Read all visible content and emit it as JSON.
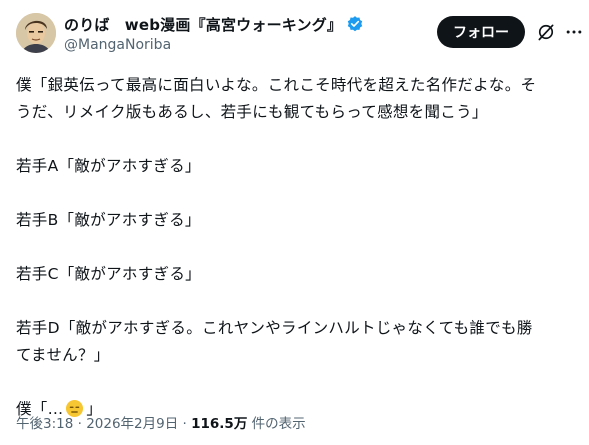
{
  "author": {
    "display_name": "のりば　web漫画『高宮ウォーキング』",
    "handle": "@MangaNoriba"
  },
  "actions": {
    "follow_label": "フォロー"
  },
  "tweet": {
    "line1": "僕「銀英伝って最高に面白いよな。これこそ時代を超えた名作だよな。そ",
    "line2": "うだ、リメイク版もあるし、若手にも観てもらって感想を聞こう」",
    "line3": "若手A「敵がアホすぎる」",
    "line4": "若手B「敵がアホすぎる」",
    "line5": "若手C「敵がアホすぎる」",
    "line6": "若手D「敵がアホすぎる。これヤンやラインハルトじゃなくても誰でも勝",
    "line7": "てません？」",
    "line8_start": "僕「…",
    "line8_end": "」",
    "emoji_name": "expressionless-face"
  },
  "meta": {
    "time": "午後3:18",
    "separator1": " · ",
    "date": "2026年2月9日",
    "separator2": " · ",
    "views": "116.5万",
    "views_suffix": " 件の表示"
  },
  "colors": {
    "verified": "#1d9bf0",
    "follow_bg": "#0f1419",
    "secondary_text": "#536471"
  }
}
